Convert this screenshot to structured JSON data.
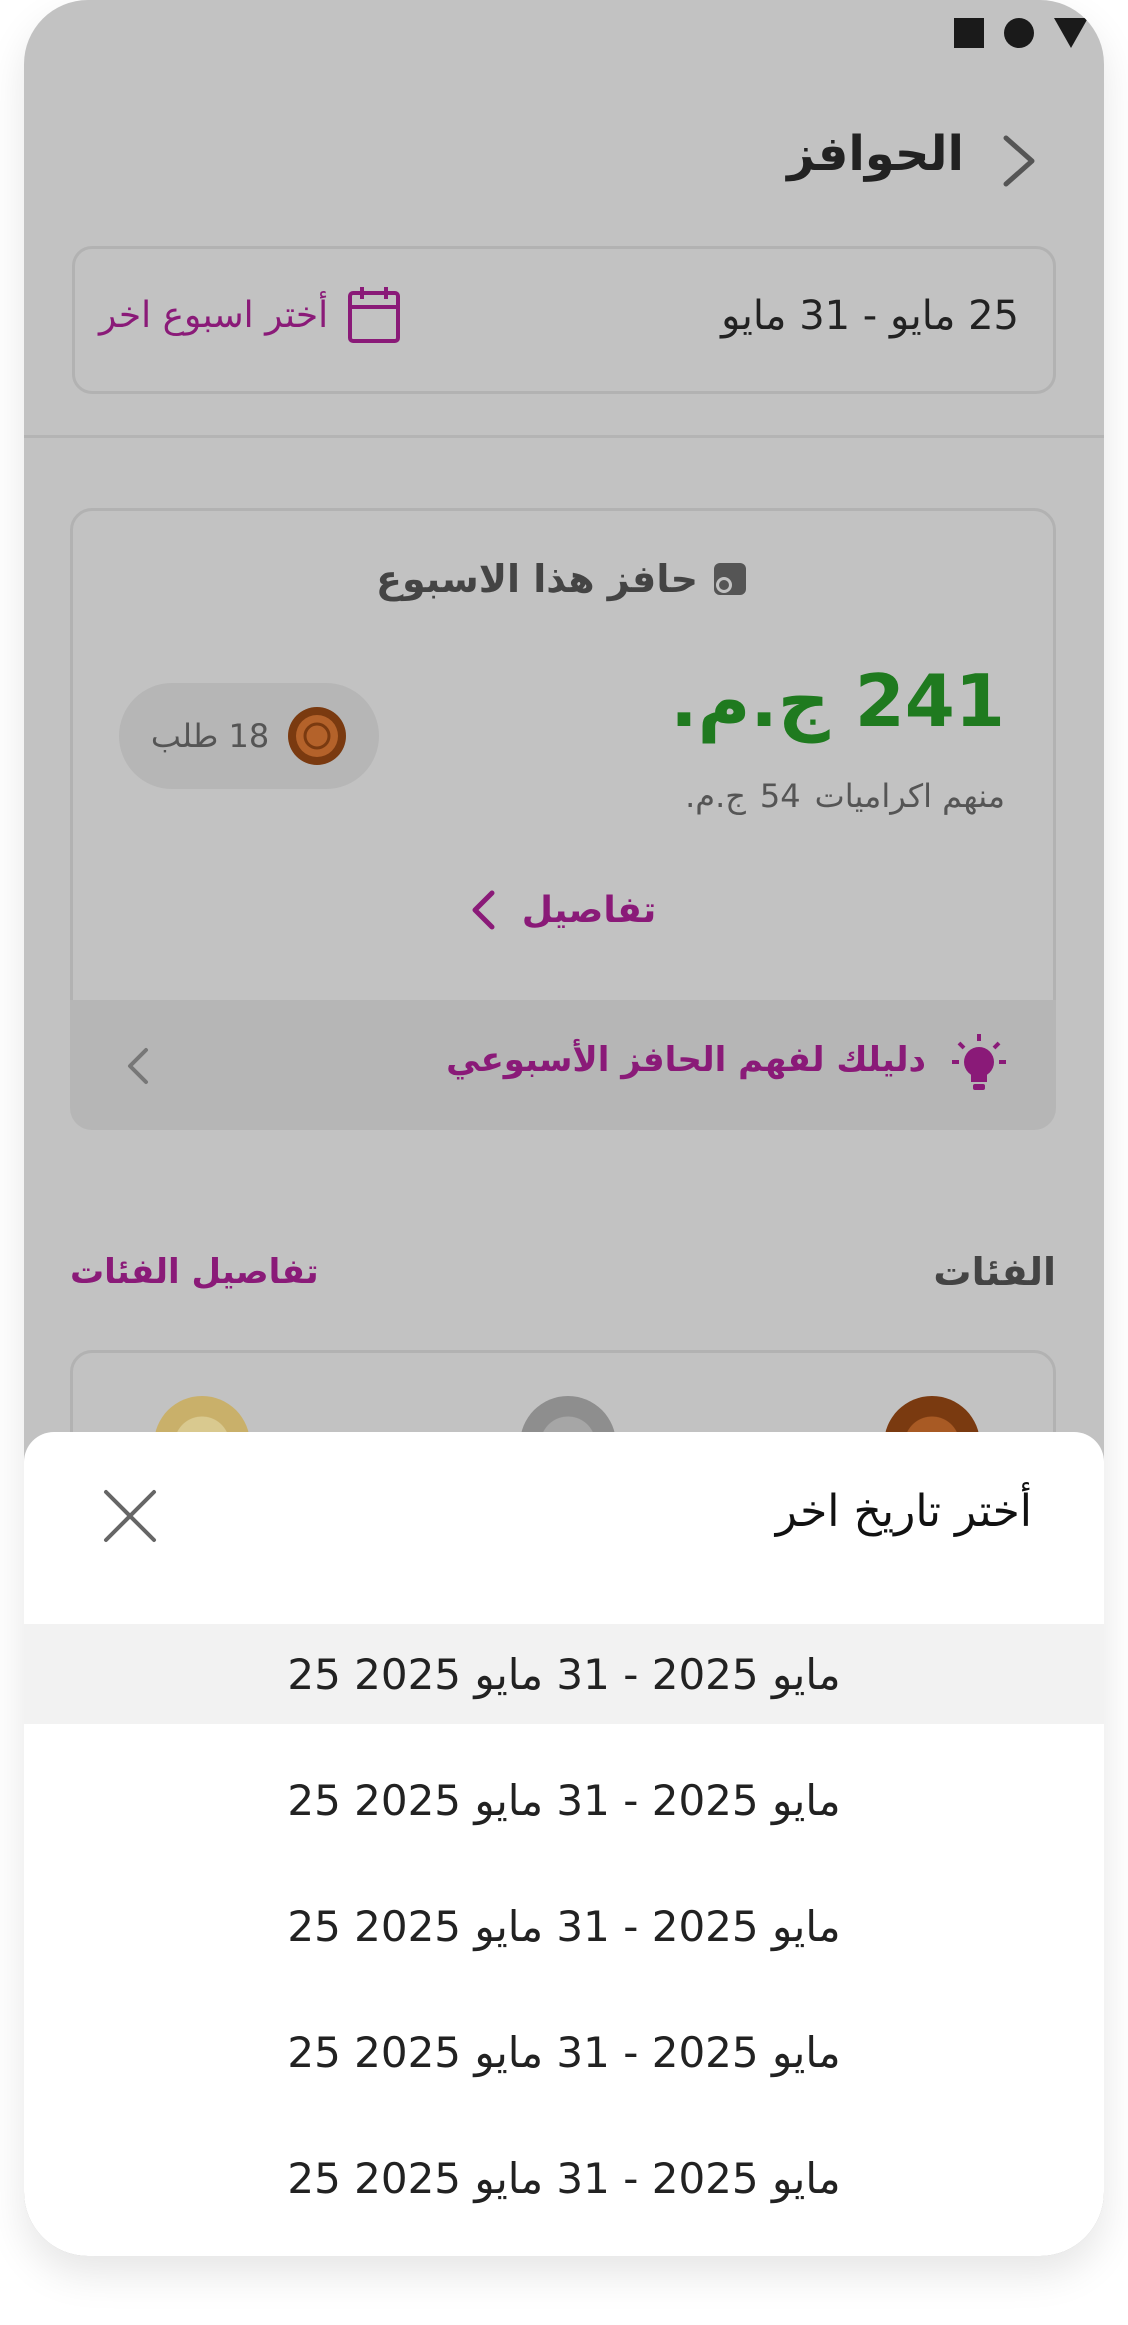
{
  "header": {
    "title": "الحوافز"
  },
  "week": {
    "range": "25 مايو - 31 مايو",
    "pick_label": "أختر اسبوع اخر"
  },
  "card": {
    "title": "حافز هذا الاسبوع",
    "amount": "241 ج.م.",
    "tips_label": "منهم اكراميات",
    "tips_value": "54",
    "tips_currency": "ج.م.",
    "orders": "18 طلب",
    "details": "تفاصيل"
  },
  "guide": {
    "label": "دليلك لفهم الحافز الأسبوعي"
  },
  "categories": {
    "title": "الفئات",
    "details_link": "تفاصيل الفئات"
  },
  "sheet": {
    "title": "أختر تاريخ اخر",
    "options": [
      "25 مايو 2025 - 31 مايو 2025",
      "25 مايو 2025 - 31 مايو 2025",
      "25 مايو 2025 - 31 مايو 2025",
      "25 مايو 2025 - 31 مايو 2025",
      "25 مايو 2025 - 31 مايو 2025"
    ]
  },
  "colors": {
    "accent": "#8a1a78",
    "amount": "#1f7a1f",
    "overlay": "#c2c2c2"
  }
}
